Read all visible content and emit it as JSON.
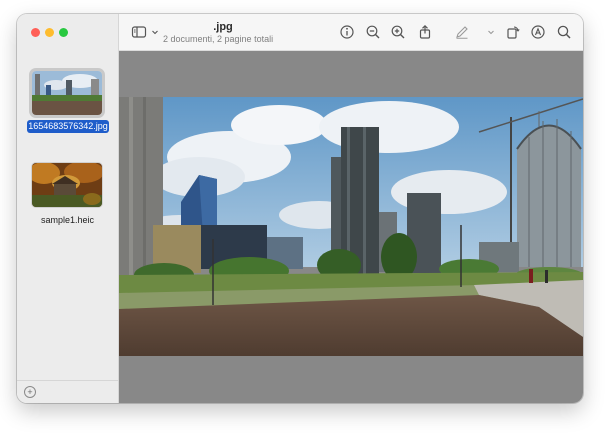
{
  "window": {
    "title": ".jpg",
    "subtitle": "2 documenti, 2 pagine totali"
  },
  "sidebar": {
    "items": [
      {
        "label": "1654683576342.jpg",
        "selected": true
      },
      {
        "label": "sample1.heic",
        "selected": false
      }
    ],
    "add_icon": "plus-circle-icon"
  },
  "toolbar": {
    "icons": [
      "sidebar-toggle-icon",
      "chevron-down-icon",
      "info-icon",
      "zoom-out-icon",
      "zoom-in-icon",
      "share-icon",
      "markup-pen-icon",
      "chevron-down-icon",
      "rotate-icon",
      "annotate-icon",
      "search-icon"
    ]
  },
  "colors": {
    "selection": "#1f5dca",
    "close": "#ff5f57",
    "minimize": "#febc2e",
    "maximize": "#28c840"
  }
}
